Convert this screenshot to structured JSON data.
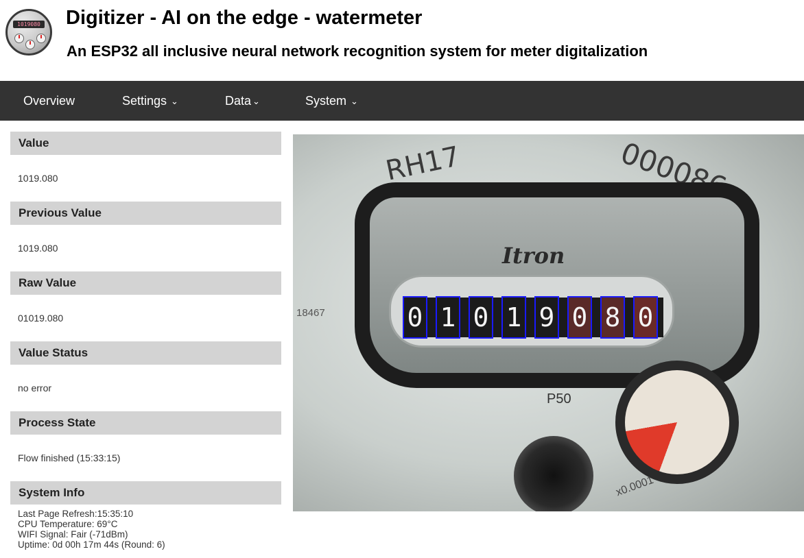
{
  "header": {
    "title": "Digitizer - AI on the edge - watermeter",
    "subtitle": "An ESP32 all inclusive neural network recognition system for meter digitalization"
  },
  "nav": [
    {
      "label": "Overview",
      "chevron": false
    },
    {
      "label": "Settings",
      "chevron": true
    },
    {
      "label": "Data",
      "chevron": true
    },
    {
      "label": "System",
      "chevron": true
    }
  ],
  "chevron_glyph": "⌄",
  "sections": {
    "value": {
      "title": "Value",
      "content": "1019.080"
    },
    "previous_value": {
      "title": "Previous Value",
      "content": "1019.080"
    },
    "raw_value": {
      "title": "Raw Value",
      "content": "01019.080"
    },
    "value_status": {
      "title": "Value Status",
      "content": "no error"
    },
    "process_state": {
      "title": "Process State",
      "content": "Flow finished (15:33:15)"
    },
    "system_info": {
      "title": "System Info",
      "lines": [
        "Last Page Refresh:15:35:10",
        "CPU Temperature: 69°C",
        "WIFI Signal: Fair (-71dBm)",
        "Uptime: 0d 00h 17m 44s (Round: 6)"
      ]
    }
  },
  "meter_image": {
    "brand": "Itron",
    "model": "RH17",
    "serial": "000086",
    "side_code": "18467",
    "p_code": "P50",
    "scale": "x0.0001",
    "digits": [
      "0",
      "1",
      "0",
      "1",
      "9",
      "0",
      "8",
      "0"
    ],
    "box_color": "#1a1aff"
  },
  "colors": {
    "navbar_bg": "#333333",
    "section_header_bg": "#d3d3d3"
  }
}
